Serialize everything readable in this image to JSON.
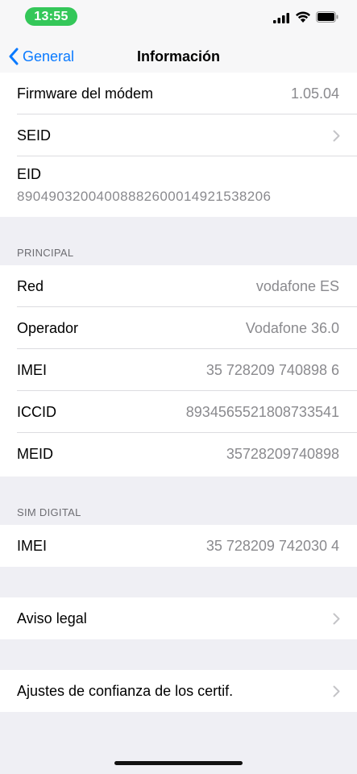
{
  "status_bar": {
    "time": "13:55"
  },
  "nav": {
    "back_label": "General",
    "title": "Información"
  },
  "top_group": {
    "firmware": {
      "label": "Firmware del módem",
      "value": "1.05.04"
    },
    "seid": {
      "label": "SEID"
    },
    "eid": {
      "label": "EID",
      "value": "89049032004008882600014921538206"
    }
  },
  "principal": {
    "header": "PRINCIPAL",
    "rows": [
      {
        "label": "Red",
        "value": "vodafone ES"
      },
      {
        "label": "Operador",
        "value": "Vodafone 36.0"
      },
      {
        "label": "IMEI",
        "value": "35 728209 740898 6"
      },
      {
        "label": "ICCID",
        "value": "8934565521808733541"
      },
      {
        "label": "MEID",
        "value": "35728209740898"
      }
    ]
  },
  "sim_digital": {
    "header": "SIM DIGITAL",
    "rows": [
      {
        "label": "IMEI",
        "value": "35 728209 742030 4"
      }
    ]
  },
  "legal": {
    "label": "Aviso legal"
  },
  "cert_trust": {
    "label": "Ajustes de confianza de los certif."
  },
  "colors": {
    "accent": "#0a7aff",
    "time_pill": "#34c759",
    "background": "#efeff4"
  }
}
